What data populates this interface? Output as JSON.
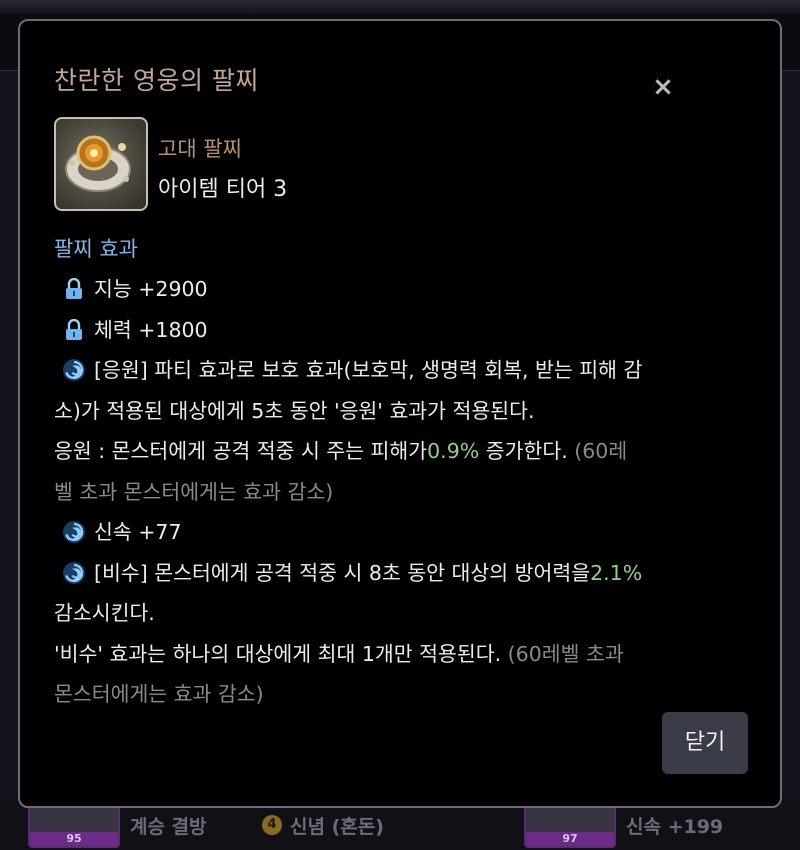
{
  "background": {
    "items": [
      {
        "level": "95",
        "text": "계승 결방",
        "badge": ""
      },
      {
        "level": "",
        "text": "신념 (혼돈)",
        "badge": "4"
      },
      {
        "level": "97",
        "text": "신속 +199",
        "badge": ""
      }
    ]
  },
  "dialog": {
    "title": "찬란한 영웅의 팔찌",
    "close_icon": "×",
    "item": {
      "icon": "bracelet-icon",
      "type": "고대 팔찌",
      "tier": "아이템 티어 3"
    },
    "section_title": "팔찌 효과",
    "effects": {
      "stat1": "지능 +2900",
      "stat2": "체력 +1800",
      "support_line1": "[응원] 파티 효과로 보호 효과(보호막, 생명력 회복, 받는 피해 감",
      "support_line2": "소)가 적용된 대상에게 5초 동안 '응원' 효과가 적용된다.",
      "support_line3_a": "응원 : 몬스터에게 공격 적중 시 주는 피해가 ",
      "support_line3_value": "0.9%",
      "support_line3_b": " 증가한다. ",
      "support_line3_note": "(60레",
      "support_line4_note": "벨 초과 몬스터에게는 효과 감소)",
      "swiftness": "신속 +77",
      "secret_line1_a": "[비수] 몬스터에게 공격 적중 시 8초 동안 대상의 방어력을 ",
      "secret_line1_value": "2.1%",
      "secret_line2": "감소시킨다.",
      "secret_line3_a": "'비수' 효과는 하나의 대상에게 최대 1개만 적용된다. ",
      "secret_line3_note": "(60레벨 초과",
      "secret_line4_note": "몬스터에게는 효과 감소)"
    },
    "close_button_label": "닫기"
  },
  "colors": {
    "title": "#c5a593",
    "item_type": "#b8916f",
    "section_title": "#7fb6e6",
    "highlight_value": "#8fd28a",
    "note": "#8a8a8a"
  }
}
